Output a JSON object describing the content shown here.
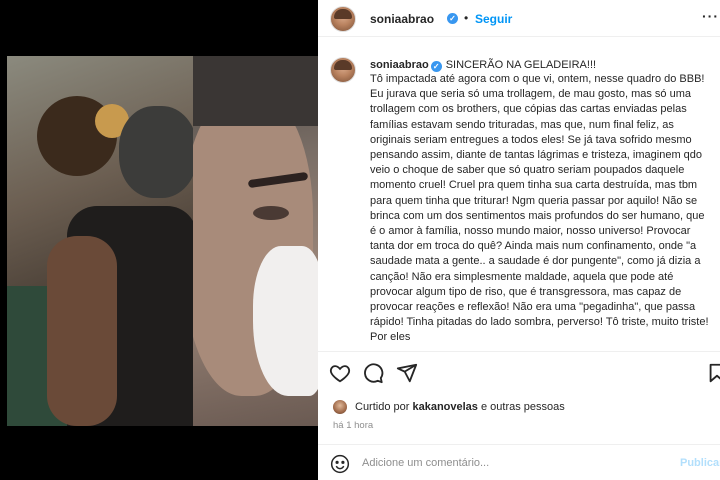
{
  "post": {
    "username": "soniaabrao",
    "verified_mark": "✓",
    "separator": "•",
    "follow_label": "Seguir",
    "more_label": "···",
    "caption_title": "SINCERÃO NA GELADEIRA!!!",
    "caption_body": "Tô impactada até agora com o que vi, ontem, nesse quadro do BBB! Eu jurava que seria só uma trollagem, de mau gosto, mas só uma trollagem com os brothers, que cópias das cartas enviadas pelas famílias estavam sendo trituradas, mas que, num final feliz, as originais seriam entregues a todos eles! Se já tava sofrido mesmo pensando assim, diante de tantas lágrimas e tristeza, imaginem qdo veio o choque de saber que só quatro seriam poupados daquele momento cruel! Cruel pra quem tinha sua carta destruída, mas tbm para quem tinha que triturar! Ngm queria passar por aquilo! Não se brinca com um dos sentimentos mais profundos do ser humano, que é o amor à família, nosso mundo maior, nosso universo! Provocar tanta dor em troca do quê? Ainda mais num confinamento, onde \"a saudade mata a gente.. a saudade é dor pungente\", como já dizia a canção! Não era simplesmente maldade, aquela que pode até provocar algum tipo de riso, que é transgressora, mas capaz de provocar reações e reflexão! Não era uma \"pegadinha\", que passa rápido! Tinha pitadas do lado sombra, perverso! Tô triste, muito triste! Por eles",
    "likes_prefix": "Curtido por",
    "likes_user": "kakanovelas",
    "likes_suffix": "e outras pessoas",
    "timestamp": "há 1 hora",
    "comment_placeholder": "Adicione um comentário...",
    "publish_label": "Publicar"
  },
  "icons": {
    "heart": "heart-icon",
    "comment": "comment-icon",
    "share": "share-icon",
    "save": "bookmark-icon",
    "emoji": "emoji-icon"
  },
  "colors": {
    "accent": "#0095f6",
    "verified": "#3897f0",
    "muted": "#8e8e8e",
    "publish_disabled": "#b2dffc"
  }
}
